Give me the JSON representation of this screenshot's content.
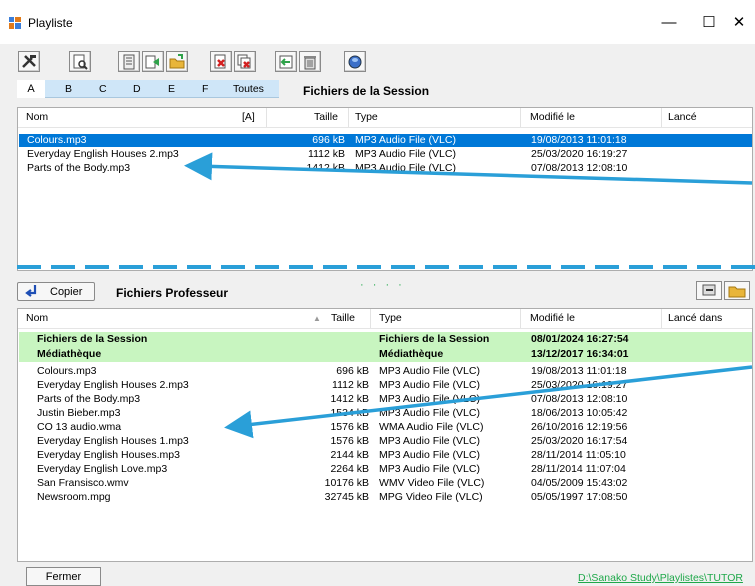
{
  "window": {
    "title": "Playliste",
    "minimize": "—",
    "maximize": "☐",
    "close": "✕"
  },
  "letter_tabs": [
    "A",
    "B",
    "C",
    "D",
    "E",
    "F",
    "Toutes"
  ],
  "session": {
    "heading": "Fichiers de la Session",
    "columns": {
      "name": "Nom",
      "flag": "[A]",
      "size": "Taille",
      "type": "Type",
      "modified": "Modifié le",
      "launched": "Lancé"
    },
    "rows": [
      {
        "name": "Colours.mp3",
        "size": "696 kB",
        "type": "MP3 Audio File (VLC)",
        "modified": "19/08/2013 11:01:18"
      },
      {
        "name": "Everyday English Houses 2.mp3",
        "size": "1112 kB",
        "type": "MP3 Audio File (VLC)",
        "modified": "25/03/2020 16:19:27"
      },
      {
        "name": "Parts of the Body.mp3",
        "size": "1412 kB",
        "type": "MP3 Audio File (VLC)",
        "modified": "07/08/2013 12:08:10"
      }
    ]
  },
  "professor": {
    "copy_label": "Copier",
    "heading": "Fichiers Professeur",
    "dots": "· · · ·",
    "columns": {
      "name": "Nom",
      "sort": "▲",
      "size": "Taille",
      "type": "Type",
      "modified": "Modifié le",
      "launched": "Lancé dans"
    },
    "folders": [
      {
        "name": "Fichiers de la Session",
        "type": "Fichiers de la Session",
        "modified": "08/01/2024 16:27:54"
      },
      {
        "name": "Médiathèque",
        "type": "Médiathèque",
        "modified": "13/12/2017 16:34:01"
      }
    ],
    "rows": [
      {
        "name": "Colours.mp3",
        "size": "696 kB",
        "type": "MP3 Audio File (VLC)",
        "modified": "19/08/2013 11:01:18"
      },
      {
        "name": "Everyday English Houses 2.mp3",
        "size": "1112 kB",
        "type": "MP3 Audio File (VLC)",
        "modified": "25/03/2020 16:19:27"
      },
      {
        "name": "Parts of the Body.mp3",
        "size": "1412 kB",
        "type": "MP3 Audio File (VLC)",
        "modified": "07/08/2013 12:08:10"
      },
      {
        "name": "Justin Bieber.mp3",
        "size": "1534 kB",
        "type": "MP3 Audio File (VLC)",
        "modified": "18/06/2013 10:05:42"
      },
      {
        "name": "CO 13 audio.wma",
        "size": "1576 kB",
        "type": "WMA Audio File (VLC)",
        "modified": "26/10/2016 12:19:56"
      },
      {
        "name": "Everyday English Houses 1.mp3",
        "size": "1576 kB",
        "type": "MP3 Audio File (VLC)",
        "modified": "25/03/2020 16:17:54"
      },
      {
        "name": "Everyday English Houses.mp3",
        "size": "2144 kB",
        "type": "MP3 Audio File (VLC)",
        "modified": "28/11/2014 11:05:10"
      },
      {
        "name": "Everyday English Love.mp3",
        "size": "2264 kB",
        "type": "MP3 Audio File (VLC)",
        "modified": "28/11/2014 11:07:04"
      },
      {
        "name": "San Fransisco.wmv",
        "size": "10176 kB",
        "type": "WMV Video File (VLC)",
        "modified": "04/05/2009 15:43:02"
      },
      {
        "name": "Newsroom.mpg",
        "size": "32745 kB",
        "type": "MPG Video File (VLC)",
        "modified": "05/05/1997 17:08:50"
      }
    ]
  },
  "footer": {
    "close_label": "Fermer",
    "path": "D:\\Sanako Study\\Playlistes\\TUTOR"
  },
  "colors": {
    "selection": "#0078d7",
    "folder_row": "#c8f5c0",
    "accent": "#1fa84a",
    "arrow": "#2a9fd8",
    "tabs": "#cfe6f8"
  },
  "icons": {
    "toolbar": [
      "tools-icon",
      "preview-icon",
      "list-icon",
      "add-file-icon",
      "open-folder-icon",
      "delete-icon",
      "delete-all-icon",
      "import-icon",
      "trash-icon",
      "disk-icon"
    ]
  }
}
